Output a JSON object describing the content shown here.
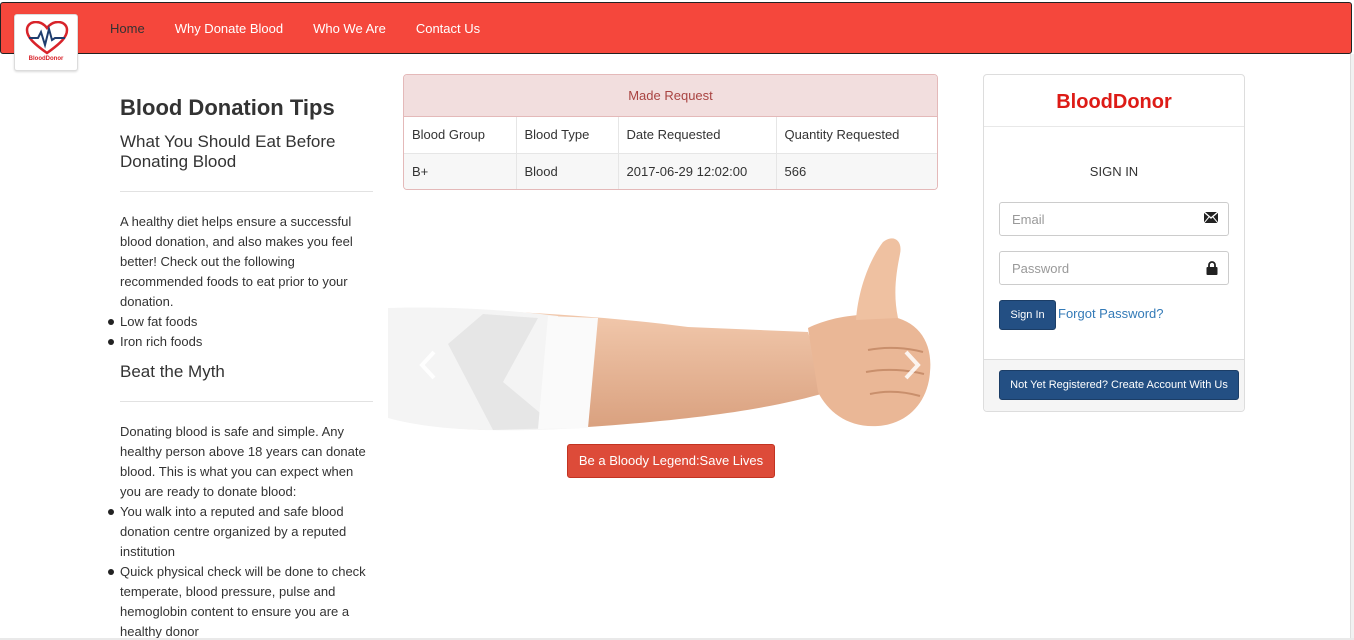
{
  "brand": {
    "name": "BloodDonor",
    "logo_icon": "heart-pulse-icon"
  },
  "nav": {
    "items": [
      {
        "label": "Home",
        "active": true
      },
      {
        "label": "Why Donate Blood",
        "active": false
      },
      {
        "label": "Who We Are",
        "active": false
      },
      {
        "label": "Contact Us",
        "active": false
      }
    ],
    "bg_color": "#f5473c"
  },
  "tips": {
    "title": "Blood Donation Tips",
    "section1": {
      "heading": "What You Should Eat Before Donating Blood",
      "intro": "A healthy diet helps ensure a successful blood donation, and also makes you feel better! Check out the following recommended foods to eat prior to your donation.",
      "items": [
        "Low fat foods",
        "Iron rich foods"
      ]
    },
    "section2": {
      "heading": "Beat the Myth",
      "intro": "Donating blood is safe and simple. Any healthy person above 18 years can donate blood. This is what you can expect when you are ready to donate blood:",
      "items": [
        "You walk into a reputed and safe blood donation centre organized by a reputed institution",
        "Quick physical check will be done to check temperate, blood pressure, pulse and hemoglobin content to ensure you are a healthy donor"
      ]
    }
  },
  "request": {
    "panel_title": "Made Request",
    "columns": [
      "Blood Group",
      "Blood Type",
      "Date Requested",
      "Quantity Requested"
    ],
    "rows": [
      [
        "B+",
        "Blood",
        "2017-06-29 12:02:00",
        "566"
      ]
    ]
  },
  "carousel": {
    "prev_icon": "chevron-left-icon",
    "next_icon": "chevron-right-icon",
    "cta_label": "Be a Bloody Legend:Save Lives"
  },
  "login": {
    "title": "BloodDonor",
    "subtitle": "SIGN IN",
    "email_placeholder": "Email",
    "password_placeholder": "Password",
    "signin_label": "Sign In",
    "forgot_label": "Forgot Password?",
    "register_label": "Not Yet Registered? Create Account With Us",
    "accent_color": "#dd1b16",
    "button_color": "#234f83"
  }
}
